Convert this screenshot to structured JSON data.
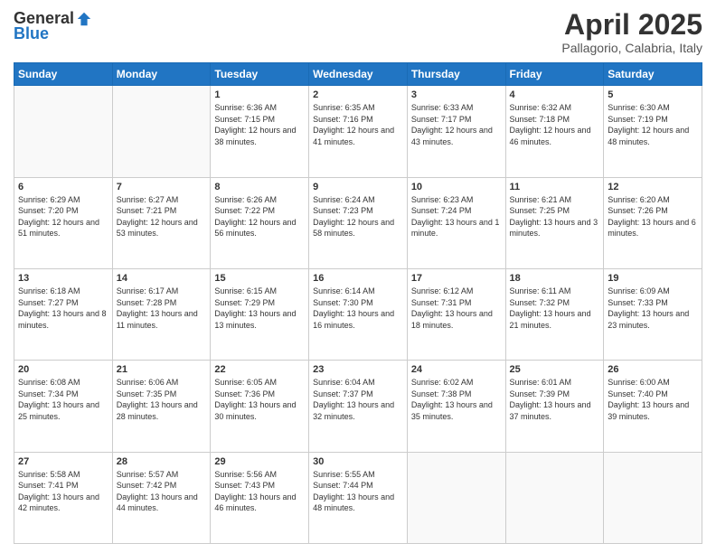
{
  "header": {
    "logo_general": "General",
    "logo_blue": "Blue",
    "month_title": "April 2025",
    "subtitle": "Pallagorio, Calabria, Italy"
  },
  "calendar": {
    "days_of_week": [
      "Sunday",
      "Monday",
      "Tuesday",
      "Wednesday",
      "Thursday",
      "Friday",
      "Saturday"
    ],
    "weeks": [
      [
        {
          "day": "",
          "sunrise": "",
          "sunset": "",
          "daylight": ""
        },
        {
          "day": "",
          "sunrise": "",
          "sunset": "",
          "daylight": ""
        },
        {
          "day": "1",
          "sunrise": "Sunrise: 6:36 AM",
          "sunset": "Sunset: 7:15 PM",
          "daylight": "Daylight: 12 hours and 38 minutes."
        },
        {
          "day": "2",
          "sunrise": "Sunrise: 6:35 AM",
          "sunset": "Sunset: 7:16 PM",
          "daylight": "Daylight: 12 hours and 41 minutes."
        },
        {
          "day": "3",
          "sunrise": "Sunrise: 6:33 AM",
          "sunset": "Sunset: 7:17 PM",
          "daylight": "Daylight: 12 hours and 43 minutes."
        },
        {
          "day": "4",
          "sunrise": "Sunrise: 6:32 AM",
          "sunset": "Sunset: 7:18 PM",
          "daylight": "Daylight: 12 hours and 46 minutes."
        },
        {
          "day": "5",
          "sunrise": "Sunrise: 6:30 AM",
          "sunset": "Sunset: 7:19 PM",
          "daylight": "Daylight: 12 hours and 48 minutes."
        }
      ],
      [
        {
          "day": "6",
          "sunrise": "Sunrise: 6:29 AM",
          "sunset": "Sunset: 7:20 PM",
          "daylight": "Daylight: 12 hours and 51 minutes."
        },
        {
          "day": "7",
          "sunrise": "Sunrise: 6:27 AM",
          "sunset": "Sunset: 7:21 PM",
          "daylight": "Daylight: 12 hours and 53 minutes."
        },
        {
          "day": "8",
          "sunrise": "Sunrise: 6:26 AM",
          "sunset": "Sunset: 7:22 PM",
          "daylight": "Daylight: 12 hours and 56 minutes."
        },
        {
          "day": "9",
          "sunrise": "Sunrise: 6:24 AM",
          "sunset": "Sunset: 7:23 PM",
          "daylight": "Daylight: 12 hours and 58 minutes."
        },
        {
          "day": "10",
          "sunrise": "Sunrise: 6:23 AM",
          "sunset": "Sunset: 7:24 PM",
          "daylight": "Daylight: 13 hours and 1 minute."
        },
        {
          "day": "11",
          "sunrise": "Sunrise: 6:21 AM",
          "sunset": "Sunset: 7:25 PM",
          "daylight": "Daylight: 13 hours and 3 minutes."
        },
        {
          "day": "12",
          "sunrise": "Sunrise: 6:20 AM",
          "sunset": "Sunset: 7:26 PM",
          "daylight": "Daylight: 13 hours and 6 minutes."
        }
      ],
      [
        {
          "day": "13",
          "sunrise": "Sunrise: 6:18 AM",
          "sunset": "Sunset: 7:27 PM",
          "daylight": "Daylight: 13 hours and 8 minutes."
        },
        {
          "day": "14",
          "sunrise": "Sunrise: 6:17 AM",
          "sunset": "Sunset: 7:28 PM",
          "daylight": "Daylight: 13 hours and 11 minutes."
        },
        {
          "day": "15",
          "sunrise": "Sunrise: 6:15 AM",
          "sunset": "Sunset: 7:29 PM",
          "daylight": "Daylight: 13 hours and 13 minutes."
        },
        {
          "day": "16",
          "sunrise": "Sunrise: 6:14 AM",
          "sunset": "Sunset: 7:30 PM",
          "daylight": "Daylight: 13 hours and 16 minutes."
        },
        {
          "day": "17",
          "sunrise": "Sunrise: 6:12 AM",
          "sunset": "Sunset: 7:31 PM",
          "daylight": "Daylight: 13 hours and 18 minutes."
        },
        {
          "day": "18",
          "sunrise": "Sunrise: 6:11 AM",
          "sunset": "Sunset: 7:32 PM",
          "daylight": "Daylight: 13 hours and 21 minutes."
        },
        {
          "day": "19",
          "sunrise": "Sunrise: 6:09 AM",
          "sunset": "Sunset: 7:33 PM",
          "daylight": "Daylight: 13 hours and 23 minutes."
        }
      ],
      [
        {
          "day": "20",
          "sunrise": "Sunrise: 6:08 AM",
          "sunset": "Sunset: 7:34 PM",
          "daylight": "Daylight: 13 hours and 25 minutes."
        },
        {
          "day": "21",
          "sunrise": "Sunrise: 6:06 AM",
          "sunset": "Sunset: 7:35 PM",
          "daylight": "Daylight: 13 hours and 28 minutes."
        },
        {
          "day": "22",
          "sunrise": "Sunrise: 6:05 AM",
          "sunset": "Sunset: 7:36 PM",
          "daylight": "Daylight: 13 hours and 30 minutes."
        },
        {
          "day": "23",
          "sunrise": "Sunrise: 6:04 AM",
          "sunset": "Sunset: 7:37 PM",
          "daylight": "Daylight: 13 hours and 32 minutes."
        },
        {
          "day": "24",
          "sunrise": "Sunrise: 6:02 AM",
          "sunset": "Sunset: 7:38 PM",
          "daylight": "Daylight: 13 hours and 35 minutes."
        },
        {
          "day": "25",
          "sunrise": "Sunrise: 6:01 AM",
          "sunset": "Sunset: 7:39 PM",
          "daylight": "Daylight: 13 hours and 37 minutes."
        },
        {
          "day": "26",
          "sunrise": "Sunrise: 6:00 AM",
          "sunset": "Sunset: 7:40 PM",
          "daylight": "Daylight: 13 hours and 39 minutes."
        }
      ],
      [
        {
          "day": "27",
          "sunrise": "Sunrise: 5:58 AM",
          "sunset": "Sunset: 7:41 PM",
          "daylight": "Daylight: 13 hours and 42 minutes."
        },
        {
          "day": "28",
          "sunrise": "Sunrise: 5:57 AM",
          "sunset": "Sunset: 7:42 PM",
          "daylight": "Daylight: 13 hours and 44 minutes."
        },
        {
          "day": "29",
          "sunrise": "Sunrise: 5:56 AM",
          "sunset": "Sunset: 7:43 PM",
          "daylight": "Daylight: 13 hours and 46 minutes."
        },
        {
          "day": "30",
          "sunrise": "Sunrise: 5:55 AM",
          "sunset": "Sunset: 7:44 PM",
          "daylight": "Daylight: 13 hours and 48 minutes."
        },
        {
          "day": "",
          "sunrise": "",
          "sunset": "",
          "daylight": ""
        },
        {
          "day": "",
          "sunrise": "",
          "sunset": "",
          "daylight": ""
        },
        {
          "day": "",
          "sunrise": "",
          "sunset": "",
          "daylight": ""
        }
      ]
    ]
  }
}
